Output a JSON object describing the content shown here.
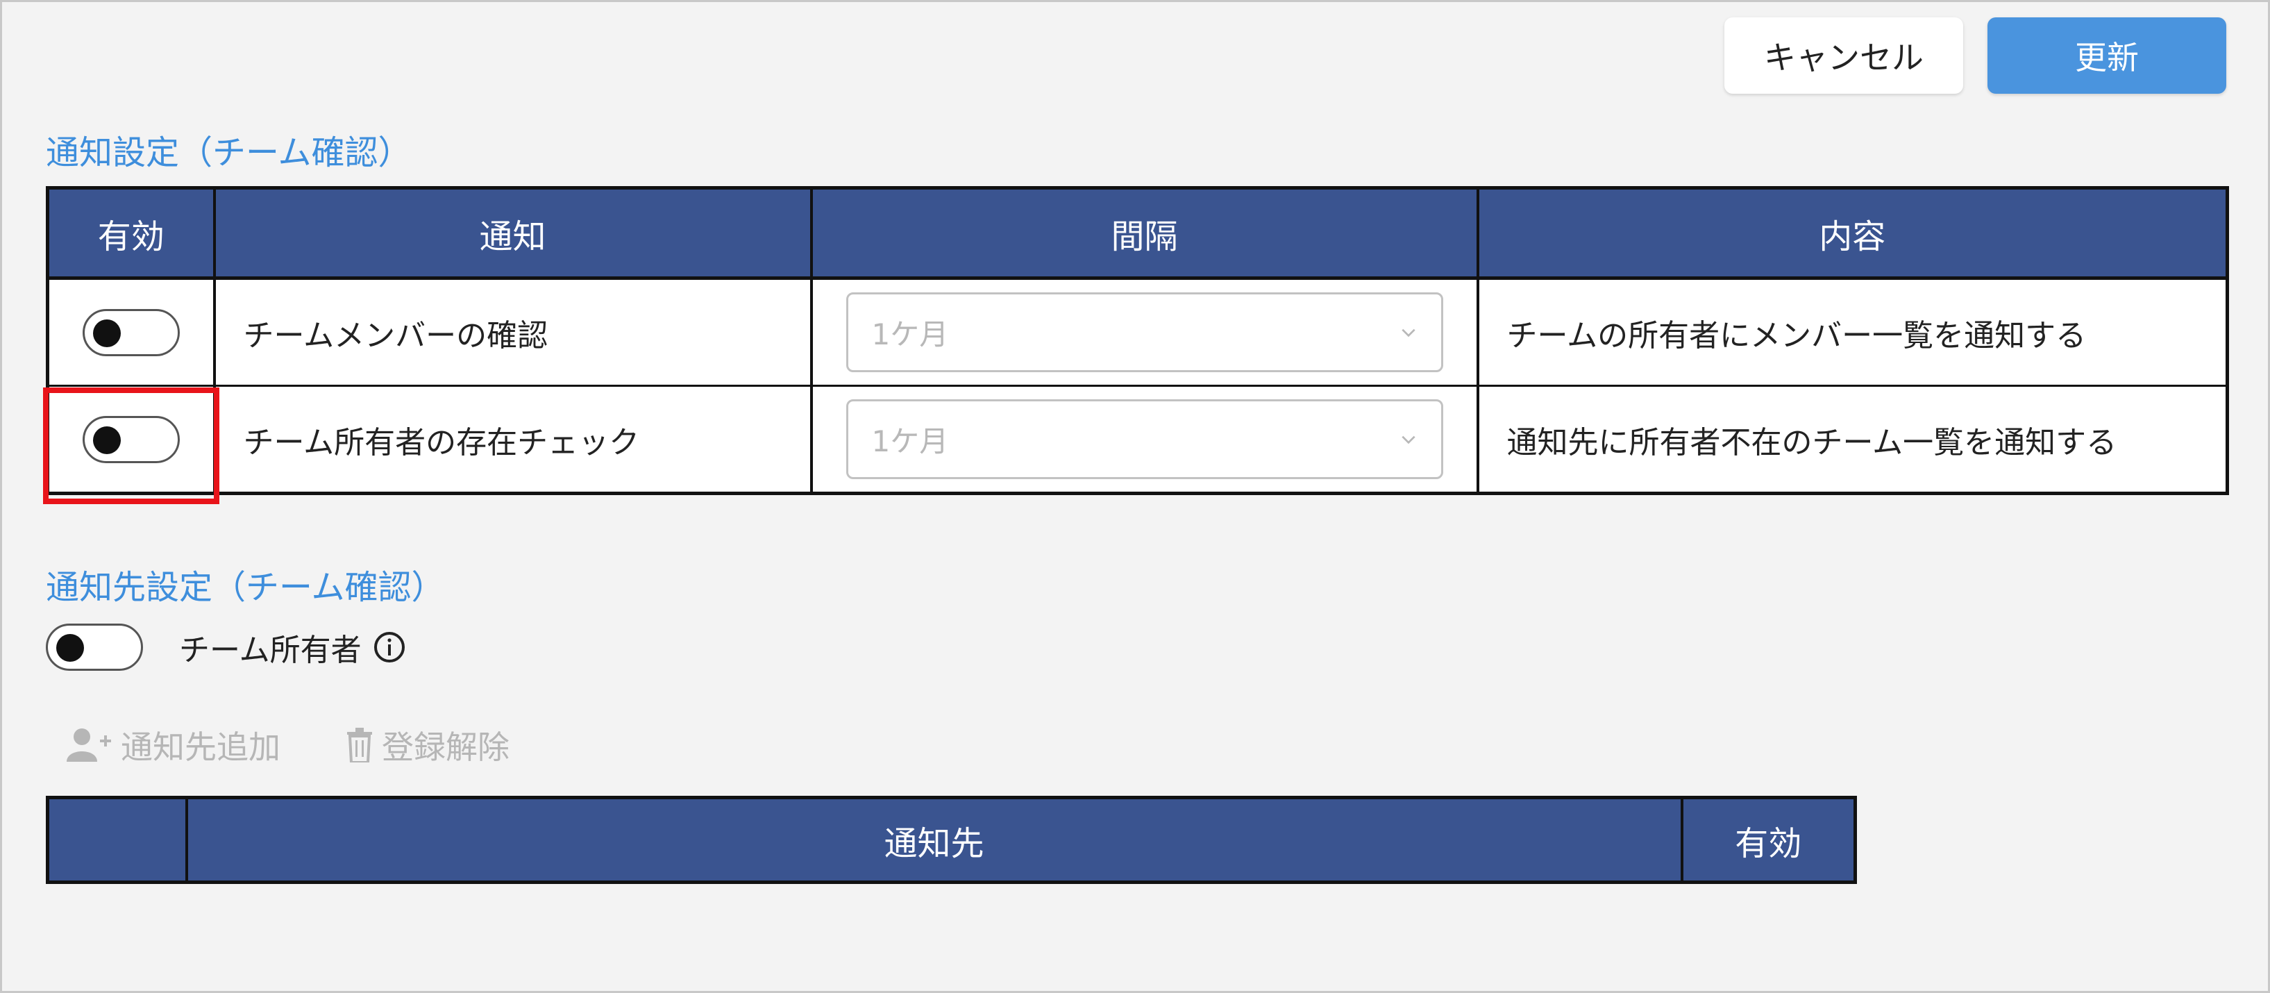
{
  "buttons": {
    "cancel": "キャンセル",
    "update": "更新"
  },
  "notification_settings": {
    "title": "通知設定（チーム確認）",
    "headers": [
      "有効",
      "通知",
      "間隔",
      "内容"
    ],
    "rows": [
      {
        "notification": "チームメンバーの確認",
        "interval": "1ケ月",
        "content": "チームの所有者にメンバー一覧を通知する",
        "enabled": false
      },
      {
        "notification": "チーム所有者の存在チェック",
        "interval": "1ケ月",
        "content": "通知先に所有者不在のチーム一覧を通知する",
        "enabled": false
      }
    ]
  },
  "recipient_settings": {
    "title": "通知先設定（チーム確認）",
    "owner_toggle_label": "チーム所有者",
    "owner_enabled": false,
    "add_label": "通知先追加",
    "remove_label": "登録解除",
    "headers": [
      "",
      "通知先",
      "有効"
    ]
  },
  "colors": {
    "accent": "#3e8edc",
    "header_bg": "#3a5490",
    "primary_button": "#4a94de",
    "highlight": "#e8141a"
  },
  "icons": [
    "chevron-down-icon",
    "info-icon",
    "add-user-icon",
    "trash-icon"
  ]
}
